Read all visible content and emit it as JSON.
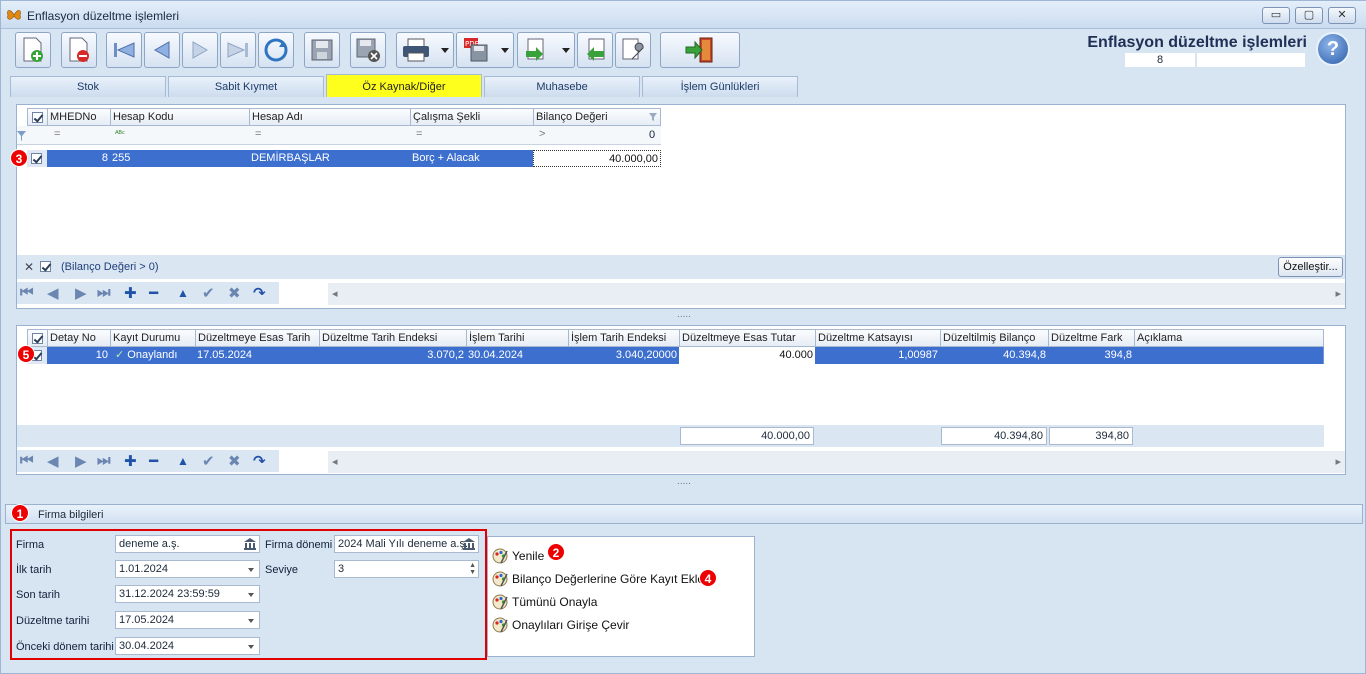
{
  "window": {
    "title": "Enflasyon düzeltme işlemleri",
    "minimize_label": "▭",
    "maximize_label": "▢",
    "close_label": "✕"
  },
  "header": {
    "title": "Enflasyon düzeltme işlemleri",
    "record_count": "8",
    "help_label": "?"
  },
  "tabs": [
    {
      "label": "Stok"
    },
    {
      "label": "Sabit Kıymet"
    },
    {
      "label": "Öz Kaynak/Diğer"
    },
    {
      "label": "Muhasebe"
    },
    {
      "label": "İşlem Günlükleri"
    }
  ],
  "upper_grid": {
    "columns": [
      "MHEDNo",
      "Hesap Kodu",
      "Hesap Adı",
      "Çalışma Şekli",
      "Bilanço Değeri"
    ],
    "filter_row": {
      "mhedno": "=",
      "hesap_kodu": "ᴬᴮᶜ",
      "hesap_adi": "=",
      "calisma": "=",
      "bilanco_op": ">",
      "bilanco_val": "0"
    },
    "rows": [
      {
        "mhedno": "8",
        "hesap_kodu": "255",
        "hesap_adi": "DEMİRBAŞLAR",
        "calisma": "Borç + Alacak",
        "bilanco": "40.000,00"
      }
    ],
    "filter_text": "(Bilanço Değeri > 0)",
    "customize_label": "Özelleştir..."
  },
  "lower_grid": {
    "columns": [
      "Detay No",
      "Kayıt Durumu",
      "Düzeltmeye Esas Tarih",
      "Düzeltme Tarih Endeksi",
      "İşlem Tarihi",
      "İşlem Tarih Endeksi",
      "Düzeltmeye Esas Tutar",
      "Düzeltme Katsayısı",
      "Düzeltilmiş Bilanço",
      "Düzeltme Fark",
      "Açıklama"
    ],
    "rows": [
      {
        "detay_no": "10",
        "durum": "Onaylandı",
        "esas_tarih": "17.05.2024",
        "tarih_endeksi": "3.070,2",
        "islem_tarihi": "30.04.2024",
        "islem_endeksi": "3.040,20000",
        "esas_tutar": "40.000",
        "katsayi": "1,00987",
        "duzeltilmis": "40.394,8",
        "fark": "394,8",
        "aciklama": ""
      }
    ],
    "totals": {
      "esas_tutar": "40.000,00",
      "duzeltilmis": "40.394,80",
      "fark": "394,80"
    }
  },
  "firma": {
    "group_title": "Firma bilgileri",
    "firma_label": "Firma",
    "firma_value": "deneme a.ş.",
    "donem_label": "Firma dönemi",
    "donem_value": "2024 Mali Yılı deneme a.ş.",
    "ilk_label": "İlk tarih",
    "ilk_value": "1.01.2024",
    "seviye_label": "Seviye",
    "seviye_value": "3",
    "son_label": "Son tarih",
    "son_value": "31.12.2024 23:59:59",
    "duzeltme_label": "Düzeltme tarihi",
    "duzeltme_value": "17.05.2024",
    "onceki_label": "Önceki dönem tarihi",
    "onceki_value": "30.04.2024"
  },
  "actions": [
    {
      "label": "Yenile"
    },
    {
      "label": "Bilanço Değerlerine Göre Kayıt Ekle"
    },
    {
      "label": "Tümünü Onayla"
    },
    {
      "label": "Onaylıları Girişe Çevir"
    }
  ],
  "badges": [
    "1",
    "2",
    "3",
    "4",
    "5"
  ],
  "colors": {
    "accent": "#3d6fcf",
    "active_tab": "#ffff1e",
    "badge": "#e00000"
  }
}
